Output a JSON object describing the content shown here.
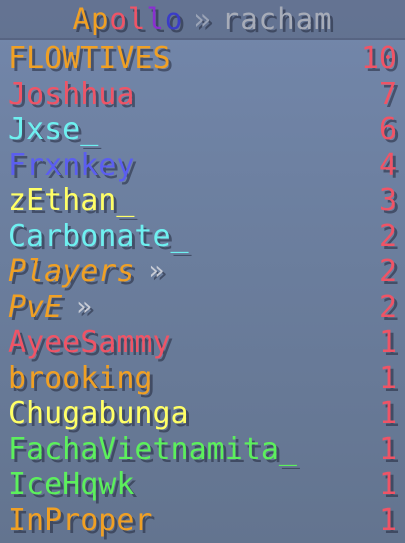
{
  "header": {
    "title_letters": [
      {
        "char": "A",
        "color": "#f0a024"
      },
      {
        "char": "p",
        "color": "#f0a024"
      },
      {
        "char": "o",
        "color": "#ef5466"
      },
      {
        "char": "l",
        "color": "#ef5466"
      },
      {
        "char": "l",
        "color": "#8a2fd0"
      },
      {
        "char": "o",
        "color": "#3a3cc8"
      }
    ],
    "separator": "»",
    "server": "racham"
  },
  "rows": [
    {
      "name": "FLOWTIVES",
      "score": "10",
      "color": "#f0a024",
      "italic": false,
      "arrow": ""
    },
    {
      "name": "Joshhua",
      "score": "7",
      "color": "#ef5466",
      "italic": false,
      "arrow": ""
    },
    {
      "name": "Jxse_",
      "score": "6",
      "color": "#6ef0f0",
      "italic": false,
      "arrow": ""
    },
    {
      "name": "Frxnkey",
      "score": "4",
      "color": "#5b5ef0",
      "italic": false,
      "arrow": ""
    },
    {
      "name": "zEthan_",
      "score": "3",
      "color": "#ffff66",
      "italic": false,
      "arrow": ""
    },
    {
      "name": "Carbonate_",
      "score": "2",
      "color": "#6ef0f0",
      "italic": false,
      "arrow": ""
    },
    {
      "name": "Players",
      "score": "2",
      "color": "#f0a024",
      "italic": true,
      "arrow": "»"
    },
    {
      "name": "PvE",
      "score": "2",
      "color": "#f0a024",
      "italic": true,
      "arrow": "»"
    },
    {
      "name": "AyeeSammy",
      "score": "1",
      "color": "#ef5466",
      "italic": false,
      "arrow": ""
    },
    {
      "name": "brooking",
      "score": "1",
      "color": "#f0a024",
      "italic": false,
      "arrow": ""
    },
    {
      "name": "Chugabunga",
      "score": "1",
      "color": "#ffff66",
      "italic": false,
      "arrow": ""
    },
    {
      "name": "FachaVietnamita_",
      "score": "1",
      "color": "#5cf05c",
      "italic": false,
      "arrow": ""
    },
    {
      "name": "IceHqwk",
      "score": "1",
      "color": "#5cf05c",
      "italic": false,
      "arrow": ""
    },
    {
      "name": "InProper",
      "score": "1",
      "color": "#f0a024",
      "italic": false,
      "arrow": ""
    }
  ],
  "score_color": "#ef5466"
}
